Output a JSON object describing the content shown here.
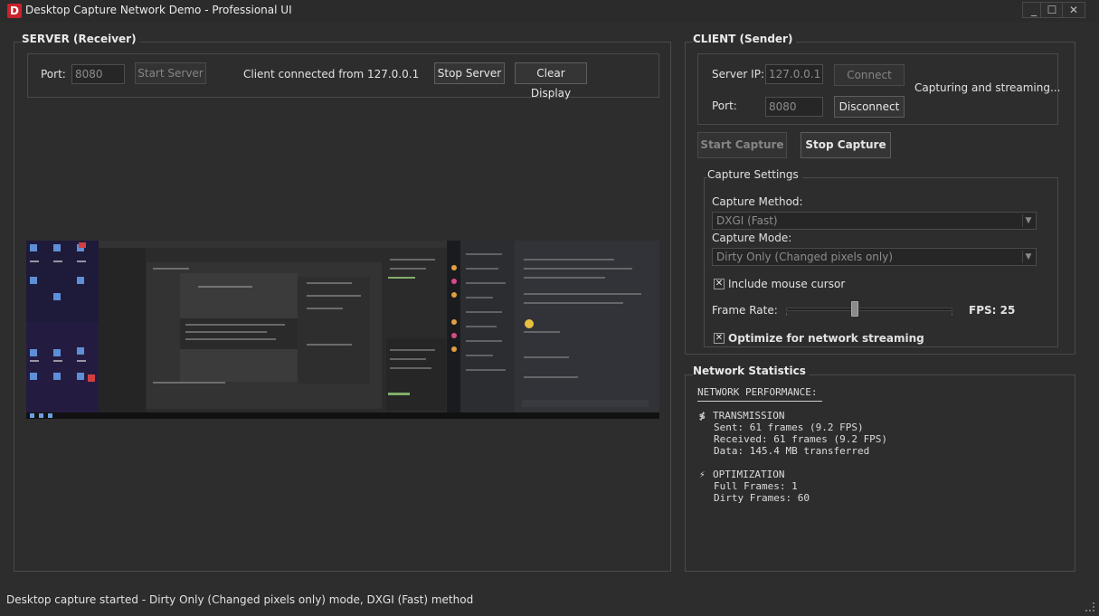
{
  "window": {
    "icon_letter": "D",
    "title": "Desktop Capture Network Demo - Professional UI",
    "min_glyph": "_",
    "max_glyph": "☐",
    "close_glyph": "✕"
  },
  "server": {
    "title": "SERVER (Receiver)",
    "port_label": "Port:",
    "port_value": "8080",
    "start_label": "Start Server",
    "status": "Client connected from 127.0.0.1",
    "stop_label": "Stop Server",
    "clear_label": "Clear Display"
  },
  "client": {
    "title": "CLIENT (Sender)",
    "ip_label": "Server IP:",
    "ip_value": "127.0.0.1",
    "connect_label": "Connect",
    "port_label": "Port:",
    "port_value": "8080",
    "disconnect_label": "Disconnect",
    "status": "Capturing and streaming...",
    "start_capture_label": "Start Capture",
    "stop_capture_label": "Stop Capture"
  },
  "capture_settings": {
    "title": "Capture Settings",
    "method_label": "Capture Method:",
    "method_value": "DXGI (Fast)",
    "mode_label": "Capture Mode:",
    "mode_value": "Dirty Only (Changed pixels only)",
    "mouse_cursor_label": "Include mouse cursor",
    "mouse_cursor_checked": true,
    "frame_rate_label": "Frame Rate:",
    "fps_text": "FPS: 25",
    "fps_value": 25,
    "optimize_label": "Optimize for network streaming",
    "optimize_checked": true,
    "check_glyph": "✕"
  },
  "network": {
    "title": "Network Statistics",
    "header": "NETWORK PERFORMANCE:",
    "transmission_icon": "chart-icon",
    "transmission_glyph": "≸",
    "transmission_title": "TRANSMISSION",
    "sent": "Sent: 61 frames (9.2 FPS)",
    "received": "Received: 61 frames (9.2 FPS)",
    "data": "Data: 145.4 MB transferred",
    "optimization_icon": "lightning-icon",
    "optimization_glyph": "⚡",
    "optimization_title": "OPTIMIZATION",
    "full_frames": "Full Frames: 1",
    "dirty_frames": "Dirty Frames: 60"
  },
  "status_bar": "Desktop capture started - Dirty Only (Changed pixels only) mode, DXGI (Fast) method"
}
